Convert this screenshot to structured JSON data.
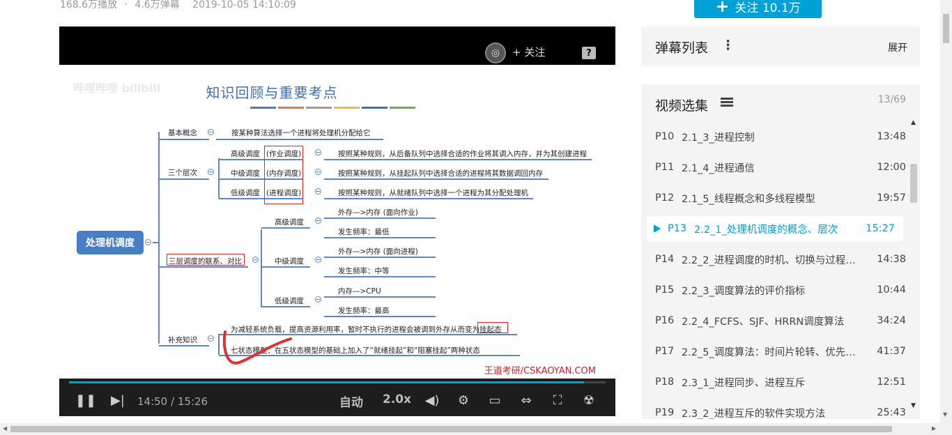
{
  "meta": {
    "plays": "168.6万播放",
    "separator": "·",
    "danmaku": "4.6万弹幕",
    "date": "2019-10-05 14:10:09"
  },
  "follow_top": {
    "plus": "+",
    "label": "关注 10.1万"
  },
  "player": {
    "follow_label": "+ 关注",
    "help_icon": "?",
    "slide": {
      "watermark": "哔哩哔哩 bilibili",
      "title": "知识回顾与重要考点",
      "color_bar": [
        "#4a7ec4",
        "#e07b3c",
        "#9b9b9b",
        "#f0b93c",
        "#3e6fb6",
        "#6ab04c"
      ],
      "root": "处理机调度",
      "basic_concept": "基本概念",
      "basic_concept_desc": "按某种算法选择一个进程将处理机分配给它",
      "three_levels": "三个层次",
      "high": "高级调度",
      "high_tag": "(作业调度)",
      "high_desc": "按照某种规则，从后备队列中选择合适的作业将其调入内存，并为其创建进程",
      "mid": "中级调度",
      "mid_tag": "(内存调度)",
      "mid_desc": "按照某种规则，从挂起队列中选择合适的进程将其数据调回内存",
      "low": "低级调度",
      "low_tag": "(进程调度)",
      "low_desc": "按照某种规则，从就绪队列中选择一个进程为其分配处理机",
      "relation": "三层调度的联系、对比",
      "r_high": "高级调度",
      "r_high_a": "外存—>内存 (面向作业)",
      "r_high_b": "发生频率：最低",
      "r_mid": "中级调度",
      "r_mid_a": "外存—>内存 (面向进程)",
      "r_mid_b": "发生频率：中等",
      "r_low": "低级调度",
      "r_low_a": "内存—>CPU",
      "r_low_b": "发生频率：最高",
      "extra": "补充知识",
      "extra_a": "为减轻系统负载，提高资源利用率，暂时不执行的进程会被调到外存从而变为",
      "extra_a_tag": "挂起态",
      "extra_b": "七状态模型：在五状态模型的基础上加入了“就绪挂起”和“阻塞挂起”两种状态",
      "credit": "王道考研/CSKAOYAN.COM"
    },
    "controls": {
      "time_current": "14:50",
      "time_sep": "/",
      "time_total": "15:26",
      "progress": 0.96,
      "quality": "自动",
      "speed": "2.0x"
    }
  },
  "danmaku_panel": {
    "title": "弹幕列表",
    "more": "⋮",
    "expand": "展开"
  },
  "playlist": {
    "title": "视频选集",
    "count": "13/69",
    "items": [
      {
        "id": "P10",
        "name": "2.1_3_进程控制",
        "duration": "13:48",
        "active": false
      },
      {
        "id": "P11",
        "name": "2.1_4_进程通信",
        "duration": "12:00",
        "active": false
      },
      {
        "id": "P12",
        "name": "2.1_5_线程概念和多线程模型",
        "duration": "19:57",
        "active": false
      },
      {
        "id": "P13",
        "name": "2.2_1_处理机调度的概念、层次",
        "duration": "15:27",
        "active": true
      },
      {
        "id": "P14",
        "name": "2.2_2_进程调度的时机、切换与过程…",
        "duration": "14:38",
        "active": false
      },
      {
        "id": "P15",
        "name": "2.2_3_调度算法的评价指标",
        "duration": "10:44",
        "active": false
      },
      {
        "id": "P16",
        "name": "2.2_4_FCFS、SJF、HRRN调度算法",
        "duration": "34:24",
        "active": false
      },
      {
        "id": "P17",
        "name": "2.2_5_调度算法：时间片轮转、优先…",
        "duration": "41:37",
        "active": false
      },
      {
        "id": "P18",
        "name": "2.3_1_进程同步、进程互斥",
        "duration": "12:51",
        "active": false
      },
      {
        "id": "P19",
        "name": "2.3_2_进程互斥的软件实现方法",
        "duration": "25:43",
        "active": false
      }
    ]
  }
}
